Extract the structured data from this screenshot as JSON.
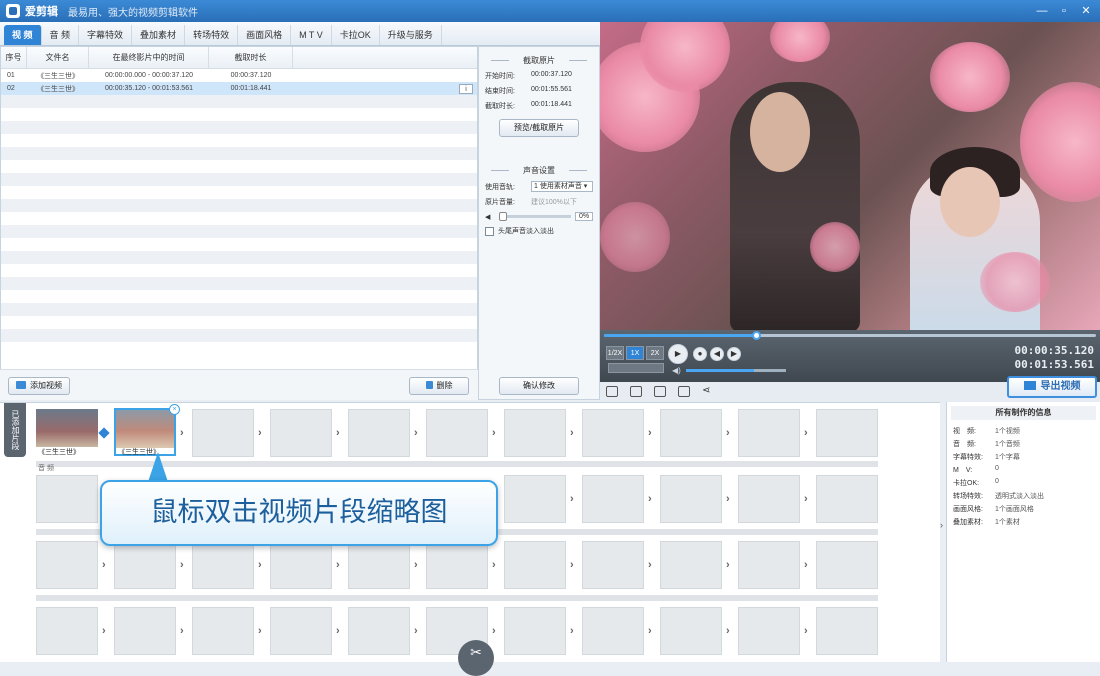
{
  "titlebar": {
    "app_name": "爱剪辑",
    "subtitle": "最易用、强大的视频剪辑软件",
    "min": "—",
    "restore": "▫",
    "close": "✕"
  },
  "tabs": [
    "视 频",
    "音 频",
    "字幕特效",
    "叠加素材",
    "转场特效",
    "画面风格",
    "M T V",
    "卡拉OK",
    "升级与服务"
  ],
  "clip_list": {
    "headers": [
      "序号",
      "文件名",
      "在最终影片中的时间",
      "截取时长"
    ],
    "rows": [
      {
        "index": "01",
        "file": "《三生三世》",
        "range": "00:00:00.000 - 00:00:37.120",
        "duration": "00:00:37.120"
      },
      {
        "index": "02",
        "file": "《三生三世》",
        "range": "00:00:35.120 - 00:01:53.561",
        "duration": "00:01:18.441"
      }
    ],
    "add_video": "添加视频",
    "delete": "删除"
  },
  "settings": {
    "clip_section": "截取原片",
    "start_label": "开始时间:",
    "start_value": "00:00:37.120",
    "end_label": "结束时间:",
    "end_value": "00:01:55.561",
    "duration_label": "截取时长:",
    "duration_value": "00:01:18.441",
    "preview_btn": "预览/截取原片",
    "sound_section": "声音设置",
    "track_label": "使用音轨:",
    "track_value": "1 使用素材声音",
    "volume_label": "原片音量:",
    "volume_hint": "建议100%以下",
    "volume_pct": "0%",
    "fade_label": "头尾声音淡入淡出",
    "confirm": "确认修改"
  },
  "player": {
    "speeds": [
      "1/2X",
      "1X",
      "2X"
    ],
    "time_current": "00:00:35.120",
    "time_total": "00:01:53.561",
    "seek_fraction": 0.31,
    "volume_fraction": 0.68,
    "export": "导出视频"
  },
  "timeline": {
    "side_label": "已添加片段",
    "audio_label": "音 频",
    "clip_caption": "《三生三世》"
  },
  "callout": "鼠标双击视频片段缩略图",
  "info": {
    "title": "所有制作的信息",
    "rows": [
      {
        "k": "视　频:",
        "v": "1个视频"
      },
      {
        "k": "音　频:",
        "v": "1个音频"
      },
      {
        "k": "字幕特效:",
        "v": "1个字幕"
      },
      {
        "k": "M　V:",
        "v": "0"
      },
      {
        "k": "卡拉OK:",
        "v": "0"
      },
      {
        "k": "转场特效:",
        "v": "透明式淡入淡出"
      },
      {
        "k": "画面风格:",
        "v": "1个画面风格"
      },
      {
        "k": "叠加素材:",
        "v": "1个素材"
      }
    ]
  },
  "colors": {
    "accent": "#2f84d6",
    "titlebar": "#2a6fb8",
    "callout_border": "#3ba3e6"
  }
}
